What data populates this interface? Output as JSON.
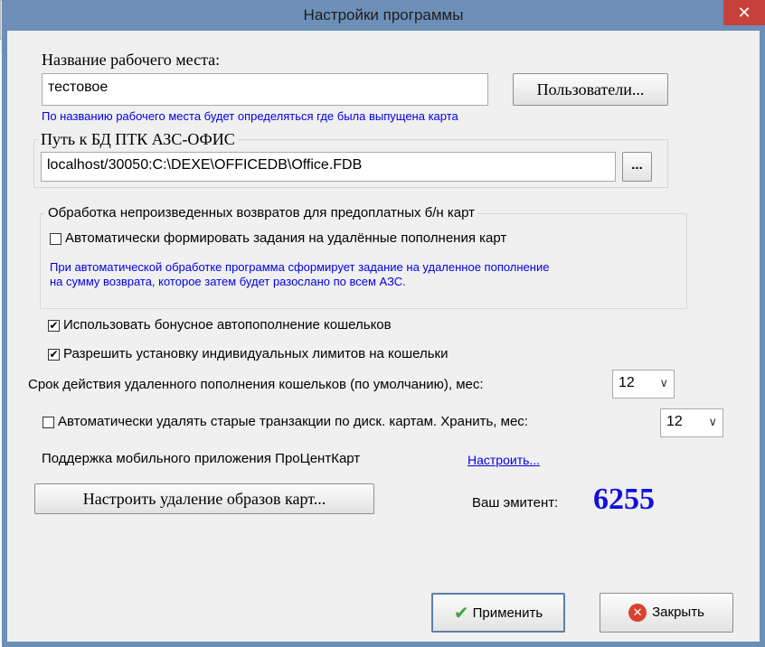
{
  "window": {
    "title": "Настройки программы",
    "close_glyph": "✕"
  },
  "workplace": {
    "label": "Название рабочего места:",
    "value": "тестовое",
    "users_button": "Пользователи...",
    "hint": "По названию рабочего места будет определяться где была выпущена карта"
  },
  "db": {
    "label": "Путь к БД ПТК АЗС-ОФИС",
    "value": "localhost/30050:C:\\DEXE\\OFFICEDB\\Office.FDB",
    "browse_button": "..."
  },
  "returns_group": {
    "title": "Обработка непроизведенных возвратов для предоплатных б/н карт",
    "auto_tasks_label": "Автоматически формировать задания на удалённые пополнения карт",
    "auto_tasks_checked": false,
    "hint_line1": "При автоматической обработке программа сформирует задание на удаленное пополнение",
    "hint_line2": "на сумму возврата, которое затем будет разослано по всем АЗС."
  },
  "options": {
    "bonus_label": "Использовать бонусное автопополнение кошельков",
    "bonus_checked": true,
    "limits_label": "Разрешить установку индивидуальных лимитов на кошельки",
    "limits_checked": true,
    "validity_label": "Срок действия удаленного пополнения кошельков (по умолчанию), мес:",
    "validity_value": "12",
    "delete_label": "Автоматически удалять старые транзакции по диск. картам. Хранить, мес:",
    "delete_checked": false,
    "delete_value": "12",
    "mobile_label": "Поддержка мобильного приложения ПроЦентКарт",
    "mobile_link": "Настроить..."
  },
  "card_images_button": "Настроить удаление образов карт...",
  "emitent": {
    "label": "Ваш эмитент:",
    "value": "6255"
  },
  "footer": {
    "apply": "Применить",
    "close": "Закрыть"
  },
  "colors": {
    "titlebar": "#6d8fb7",
    "close": "#c7403a",
    "hint": "#0000e6",
    "emitent": "#1010e0"
  },
  "icons": {
    "apply": "check-icon",
    "close": "close-circle-icon"
  }
}
